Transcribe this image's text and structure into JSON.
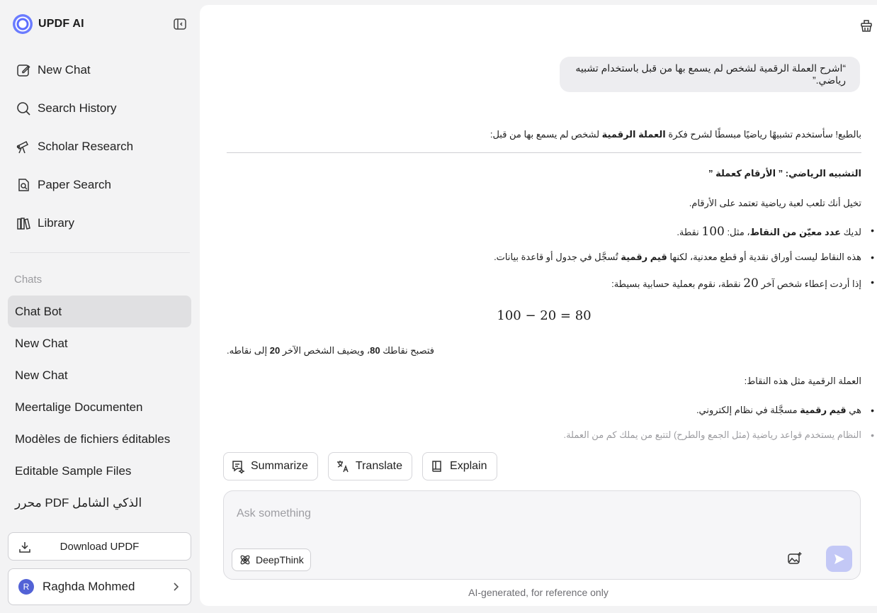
{
  "app": {
    "name": "UPDF AI"
  },
  "sidebar": {
    "nav": [
      {
        "label": "New Chat",
        "icon": "edit-icon"
      },
      {
        "label": "Search History",
        "icon": "search-icon"
      },
      {
        "label": "Scholar Research",
        "icon": "telescope-icon"
      },
      {
        "label": "Paper Search",
        "icon": "document-search-icon"
      },
      {
        "label": "Library",
        "icon": "library-icon"
      }
    ],
    "chats_heading": "Chats",
    "chats": [
      {
        "label": "Chat Bot",
        "active": true
      },
      {
        "label": "New Chat"
      },
      {
        "label": "New Chat"
      },
      {
        "label": "Meertalige Documenten"
      },
      {
        "label": "Modèles de fichiers éditables"
      },
      {
        "label": "Editable Sample Files"
      },
      {
        "label": "محرر PDF الذكي الشامل"
      }
    ],
    "download_label": "Download UPDF",
    "user": {
      "initial": "R",
      "name": "Raghda Mohmed"
    }
  },
  "conversation": {
    "user_message": "“اشرح العملة الرقمية لشخص لم يسمع بها من قبل باستخدام تشبيه رياضي.”",
    "answer": {
      "intro_pre": "بالطبع! سأستخدم تشبيهًا رياضيًا مبسطًا لشرح فكرة ",
      "intro_bold": "العملة الرقمية",
      "intro_post": " لشخص لم يسمع بها من قبل:",
      "heading": "التشبيه الرياضي: ” الأرقام كعملة ”",
      "imagine": "تخيل أنك تلعب لعبة رياضية تعتمد على الأرقام.",
      "b1_pre": "لديك ",
      "b1_bold": "عدد معيّن من النقاط",
      "b1_mid": "، مثل: ",
      "b1_num": "100",
      "b1_post": " نقطة.",
      "b2_pre": "هذه النقاط ليست أوراق نقدية أو قطع معدنية، لكنها ",
      "b2_bold": "قيم رقمية",
      "b2_post": " تُسجَّل في جدول أو قاعدة بيانات.",
      "b3_pre": "إذا أردت إعطاء شخص آخر ",
      "b3_num": "20",
      "b3_post": " نقطة، نقوم بعملية حسابية بسيطة:",
      "equation": "100 − 20 = 80",
      "result_pre": "فتصبح نقاطك ",
      "result_b1": "80",
      "result_mid": "، ويضيف الشخص الآخر ",
      "result_b2": "20",
      "result_post": " إلى نقاطه.",
      "compare": "العملة الرقمية مثل هذه النقاط:",
      "b4_pre": "هي ",
      "b4_bold": "قيم رقمية",
      "b4_post": " مسجَّلة في نظام إلكتروني.",
      "b5": "النظام يستخدم قواعد رياضية (مثل الجمع والطرح) لتتبع من يملك كم من العملة."
    }
  },
  "quick_actions": [
    {
      "label": "Summarize",
      "icon": "summarize-icon"
    },
    {
      "label": "Translate",
      "icon": "translate-icon"
    },
    {
      "label": "Explain",
      "icon": "book-icon"
    }
  ],
  "composer": {
    "placeholder": "Ask something",
    "deepthink_label": "DeepThink"
  },
  "footnote": "AI-generated, for reference only",
  "colors": {
    "accent": "#5a6bff",
    "send_button": "#c3c8f6",
    "sidebar_bg": "#f3f3f4",
    "active_chat": "#e0e0e2"
  }
}
